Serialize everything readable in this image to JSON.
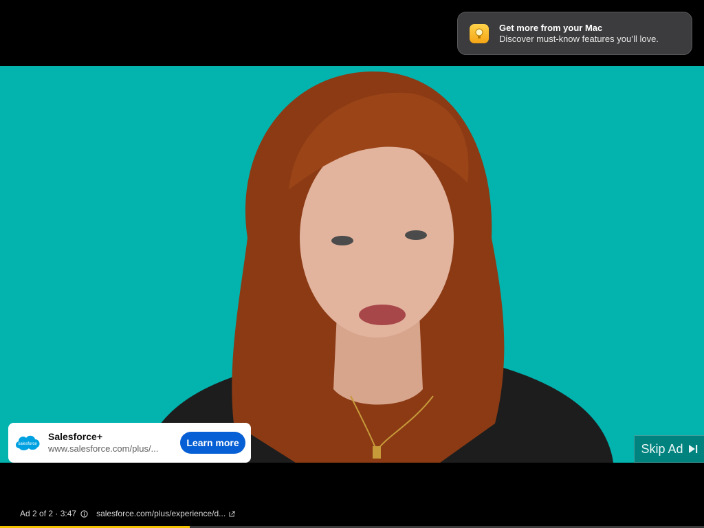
{
  "notification": {
    "title": "Get more from your Mac",
    "body": "Discover must-know features you’ll love.",
    "icon": "lightbulb-icon"
  },
  "ad_card": {
    "logo_text": "salesforce",
    "title": "Salesforce+",
    "url": "www.salesforce.com/plus/...",
    "cta_label": "Learn more"
  },
  "skip": {
    "label": "Skip Ad",
    "icon": "skip-next-icon"
  },
  "ad_info": {
    "position": "Ad 2 of 2 · 3:47",
    "link": "salesforce.com/plus/experience/d..."
  },
  "progress": {
    "fraction": 0.27
  },
  "colors": {
    "video_background": "#02b3ae",
    "cta": "#065fd4",
    "progress": "#f2c200"
  }
}
